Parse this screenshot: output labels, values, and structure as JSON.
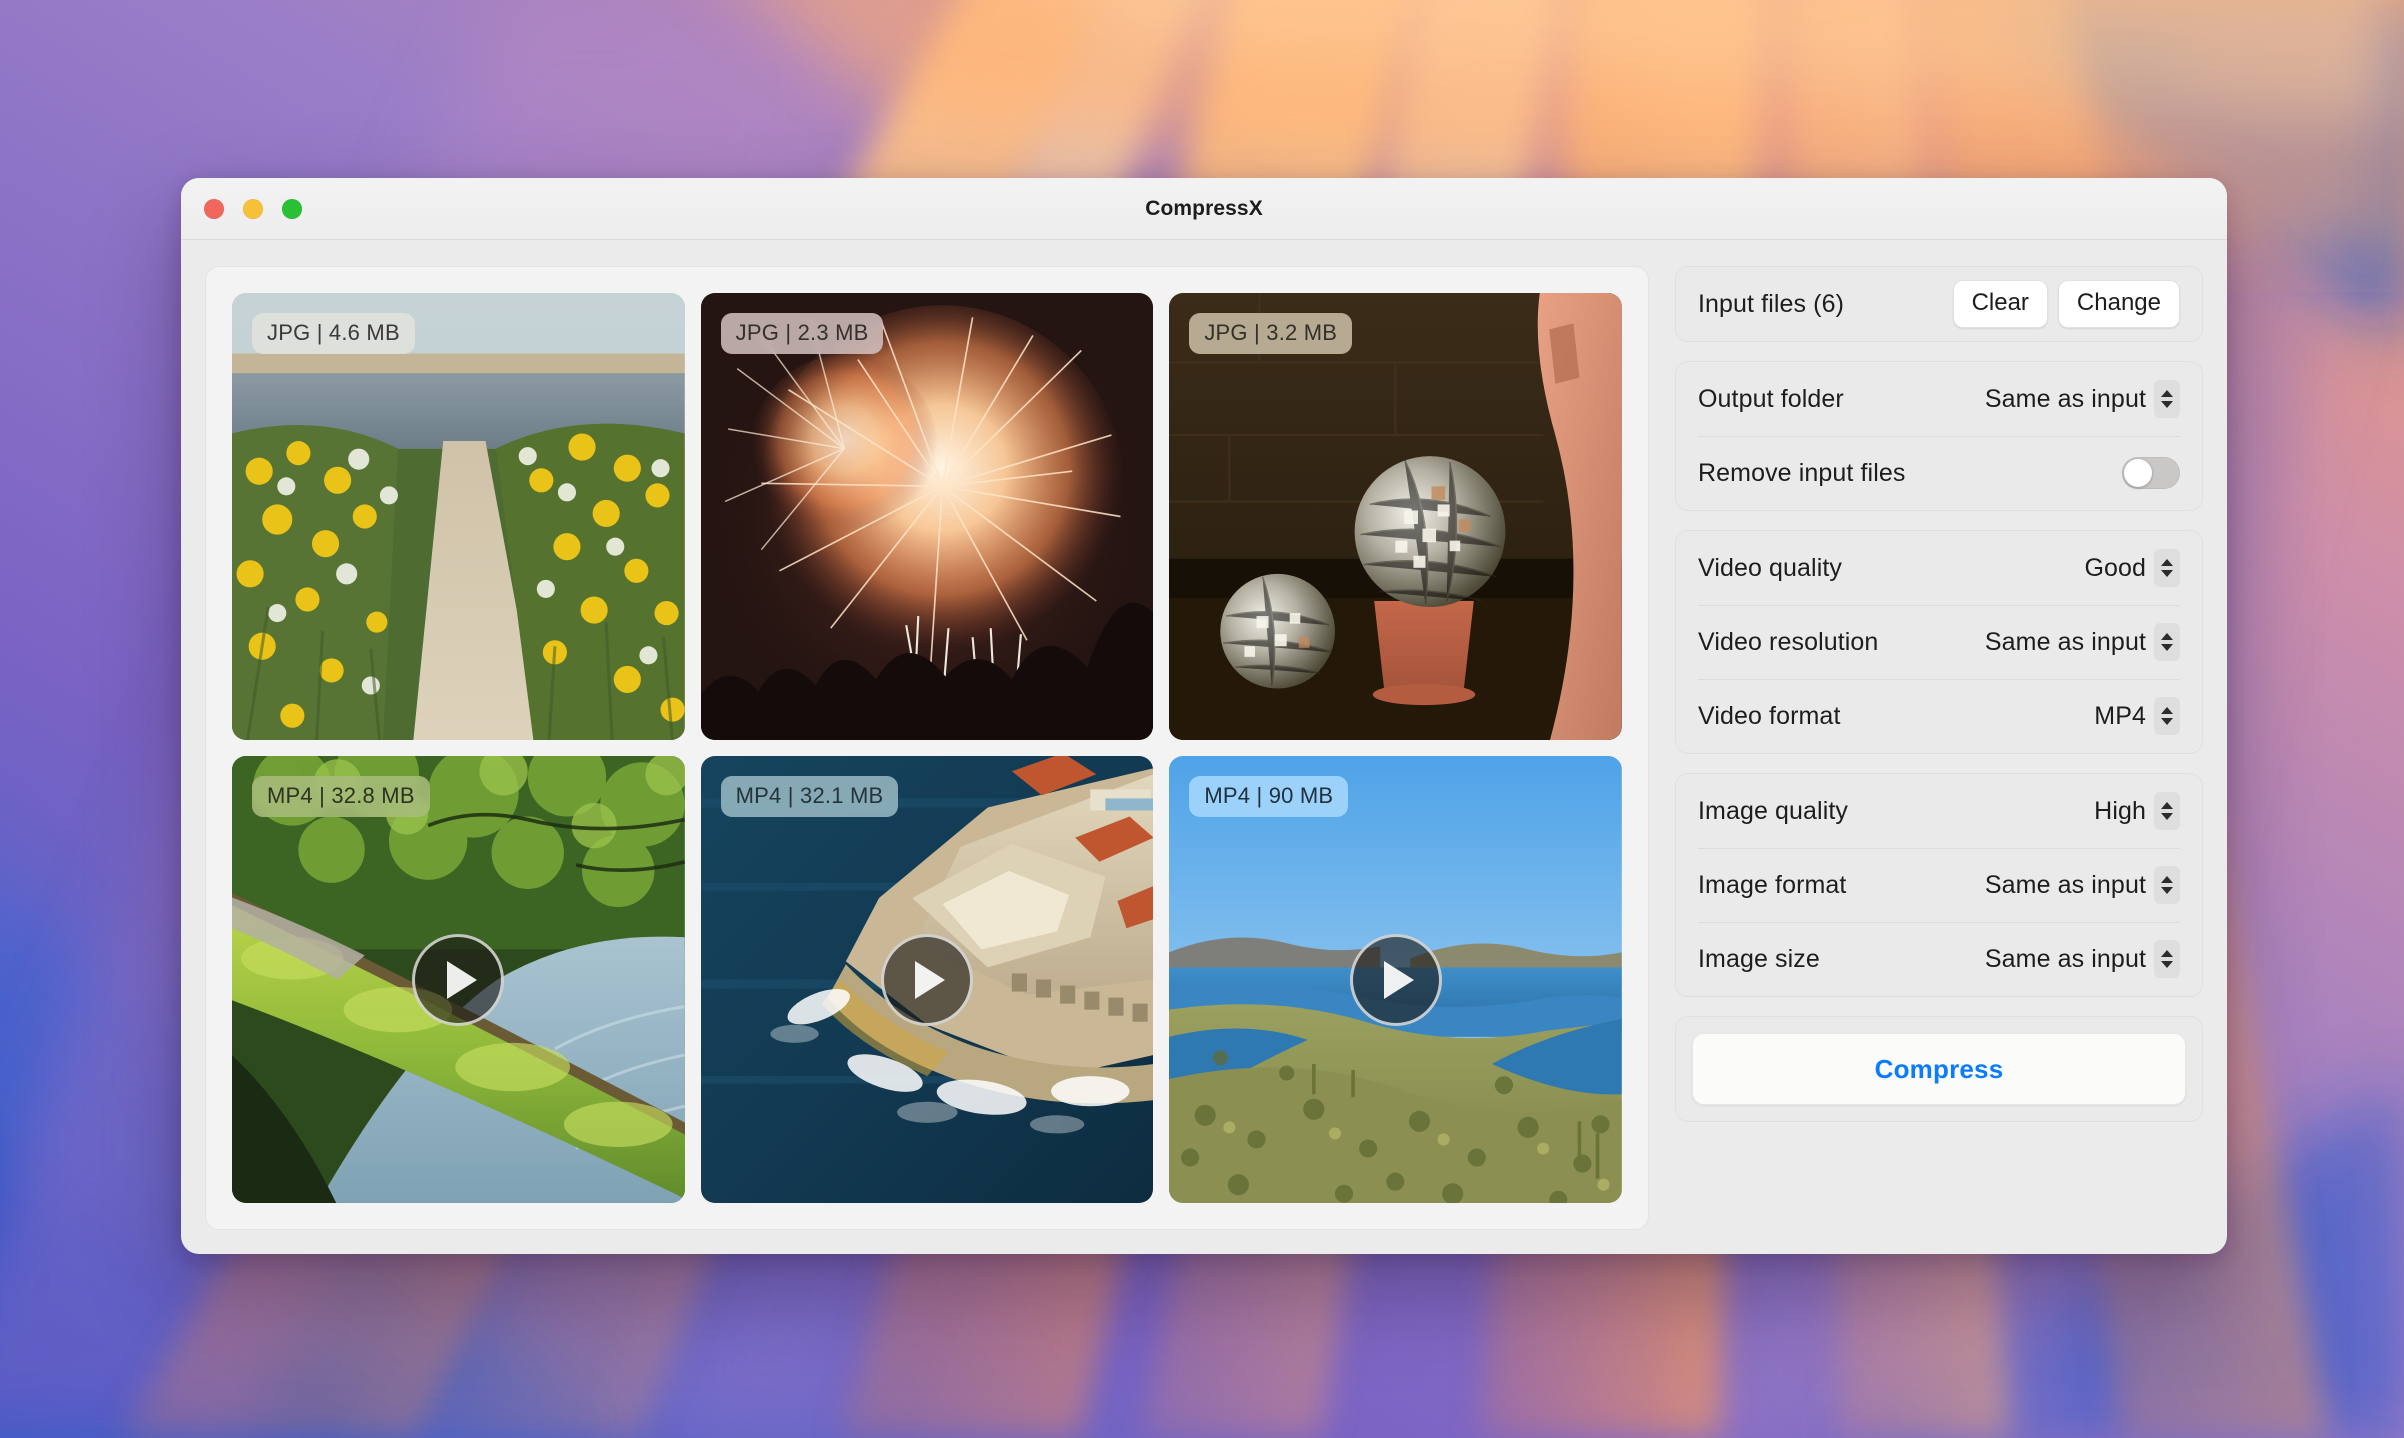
{
  "window": {
    "title": "CompressX",
    "traffic_lights": [
      {
        "name": "close",
        "color": "#f2675c"
      },
      {
        "name": "minimize",
        "color": "#f6c038"
      },
      {
        "name": "zoom",
        "color": "#2ac033"
      }
    ]
  },
  "files": [
    {
      "badge": "JPG | 4.6 MB",
      "format": "JPG",
      "size": "4.6 MB",
      "kind": "image",
      "scene": "coastal path through yellow wildflowers toward the sea",
      "badge_bg": "rgba(228,228,220,0.80)",
      "badge_color": "#3a3a3a"
    },
    {
      "badge": "JPG | 2.3 MB",
      "format": "JPG",
      "size": "2.3 MB",
      "kind": "image",
      "scene": "orange firework burst over crowd silhouettes",
      "badge_bg": "rgba(214,197,195,0.84)",
      "badge_color": "#35302f"
    },
    {
      "badge": "JPG | 3.2 MB",
      "format": "JPG",
      "size": "3.2 MB",
      "kind": "image",
      "scene": "two disco balls on a terracotta pot by a dark brick wall",
      "badge_bg": "rgba(200,188,164,0.88)",
      "badge_color": "#33302a"
    },
    {
      "badge": "MP4 | 32.8 MB",
      "format": "MP4",
      "size": "32.8 MB",
      "kind": "video",
      "scene": "mossy fallen log over a forest stream",
      "badge_bg": "rgba(166,188,122,0.88)",
      "badge_color": "#2d3320"
    },
    {
      "badge": "MP4 | 32.1 MB",
      "format": "MP4",
      "size": "32.1 MB",
      "kind": "video",
      "scene": "aerial view of a seaside fortress on a rocky island",
      "badge_bg": "rgba(150,183,194,0.88)",
      "badge_color": "#25343a"
    },
    {
      "badge": "MP4 | 90 MB",
      "format": "MP4",
      "size": "90 MB",
      "kind": "video",
      "scene": "desert lake between scrub covered hills under blue sky",
      "badge_bg": "rgba(163,214,252,0.90)",
      "badge_color": "#20313f"
    }
  ],
  "settings": {
    "input": {
      "label": "Input files (6)",
      "count": 6,
      "clear_label": "Clear",
      "change_label": "Change"
    },
    "output": {
      "folder_label": "Output folder",
      "folder_value": "Same as input",
      "remove_label": "Remove input files",
      "remove_enabled": false
    },
    "video": {
      "quality_label": "Video quality",
      "quality_value": "Good",
      "resolution_label": "Video resolution",
      "resolution_value": "Same as input",
      "format_label": "Video format",
      "format_value": "MP4"
    },
    "image": {
      "quality_label": "Image quality",
      "quality_value": "High",
      "format_label": "Image format",
      "format_value": "Same as input",
      "size_label": "Image size",
      "size_value": "Same as input"
    },
    "compress_label": "Compress",
    "accent_color": "#0a7cff"
  }
}
